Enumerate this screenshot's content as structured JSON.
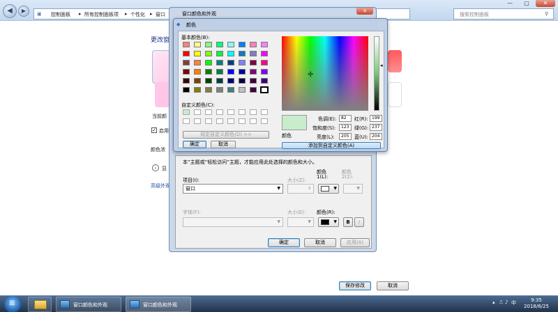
{
  "explorer": {
    "back_icon": "back-arrow",
    "forward_icon": "forward-arrow",
    "breadcrumb": [
      "控制面板",
      "所有控制面板项",
      "个性化",
      "窗口"
    ],
    "search_placeholder": "搜索控制面板",
    "win_controls": [
      "—",
      "▢",
      "✕"
    ]
  },
  "background": {
    "page_title": "更改窗",
    "current_color_label": "当前颜",
    "enable_label": "启用",
    "intensity_label": "颜色浓",
    "expand_label": "显",
    "advanced_link": "高级外观",
    "tile_colors": [
      "#ffd0ec",
      "#ffc6e7",
      "#ff8080"
    ]
  },
  "window_color_dialog": {
    "title": "窗口颜色和外观",
    "close": "✕",
    "note": "本”主题或“轻松访问”主题，才能应用此处选择的颜色和大小。",
    "item_label": "项目(I):",
    "item_value": "窗口",
    "size_label_1": "大小(Z):",
    "color1_label": "颜色",
    "color1_sub": "1(L):",
    "color2_label": "颜色",
    "color2_sub": "2(2):",
    "color1_swatch": "#ffffff",
    "font_label": "字体(F):",
    "size_label_2": "大小(E):",
    "font_color_label": "颜色(R):",
    "font_color_swatch": "#000000",
    "bold": "B",
    "italic": "I",
    "ok": "确定",
    "cancel": "取消",
    "apply": "应用(A)"
  },
  "color_picker": {
    "title": "颜色",
    "basic_colors_label": "基本颜色(B):",
    "custom_colors_label": "自定义颜色(C):",
    "define_custom": "规定自定义颜色(D) >>",
    "ok": "确定",
    "cancel": "取消",
    "add_to_custom": "添加到自定义颜色(A)",
    "preview_label": "颜色",
    "preview_color": "#c7edcc",
    "hue_label": "色调(E):",
    "hue": "82",
    "sat_label": "饱和度(S):",
    "sat": "123",
    "lum_label": "亮度(L):",
    "lum": "205",
    "red_label": "红(R):",
    "red": "199",
    "green_label": "绿(G):",
    "green": "237",
    "blue_label": "蓝(U):",
    "blue": "204",
    "basic_colors": [
      [
        "#ff8080",
        "#ffff80",
        "#80ff80",
        "#00ff80",
        "#80ffff",
        "#0080ff",
        "#ff80c0",
        "#ff80ff"
      ],
      [
        "#ff0000",
        "#ffff00",
        "#80ff00",
        "#00ff40",
        "#00ffff",
        "#0080c0",
        "#8080c0",
        "#ff00ff"
      ],
      [
        "#804040",
        "#ff8040",
        "#00ff00",
        "#008080",
        "#004080",
        "#8080ff",
        "#800040",
        "#ff0080"
      ],
      [
        "#800000",
        "#ff8000",
        "#008000",
        "#008040",
        "#0000ff",
        "#0000a0",
        "#800080",
        "#8000ff"
      ],
      [
        "#400000",
        "#804000",
        "#004000",
        "#004040",
        "#000080",
        "#000040",
        "#400040",
        "#400080"
      ],
      [
        "#000000",
        "#808000",
        "#808040",
        "#808080",
        "#408080",
        "#c0c0c0",
        "#400040",
        "#ffffff"
      ]
    ]
  },
  "page_buttons": {
    "save": "保存修改",
    "cancel": "取消"
  },
  "taskbar": {
    "items": [
      "窗口颜色和外观",
      "窗口颜色和外观"
    ],
    "lang": "中",
    "time": "9:35",
    "date": "2018/6/25"
  }
}
